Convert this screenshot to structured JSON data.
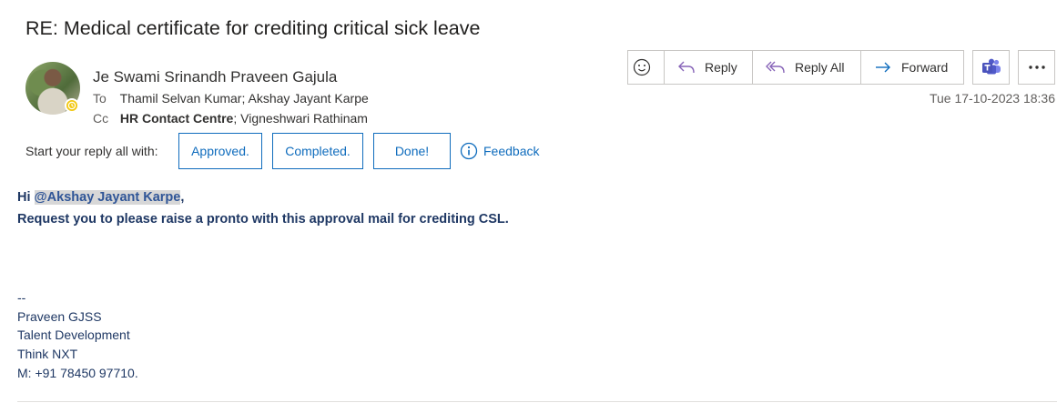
{
  "subject": "RE: Medical certificate for crediting critical sick leave",
  "sender": "Je Swami Srinandh Praveen Gajula",
  "to_label": "To",
  "to_value": "Thamil Selvan Kumar; Akshay Jayant Karpe",
  "cc_label": "Cc",
  "cc_bold": "HR Contact Centre",
  "cc_rest": "; Vigneshwari Rathinam",
  "timestamp": "Tue 17-10-2023 18:36",
  "actions": {
    "reply": "Reply",
    "reply_all": "Reply All",
    "forward": "Forward"
  },
  "suggestions": {
    "label": "Start your reply all with:",
    "items": [
      "Approved.",
      "Completed.",
      "Done!"
    ],
    "feedback": "Feedback"
  },
  "body": {
    "greeting_prefix": "Hi ",
    "mention": "@Akshay Jayant Karpe",
    "greeting_suffix": ",",
    "line2": "Request you to please raise a pronto with this approval mail for crediting CSL."
  },
  "signature": {
    "dashes": "--",
    "name": "Praveen GJSS",
    "dept": "Talent Development",
    "company": "Think NXT",
    "phone": "M: +91 78450 97710."
  },
  "colors": {
    "accent": "#0f6cbd",
    "body_text": "#1f3864",
    "presence": "#f2c811"
  }
}
